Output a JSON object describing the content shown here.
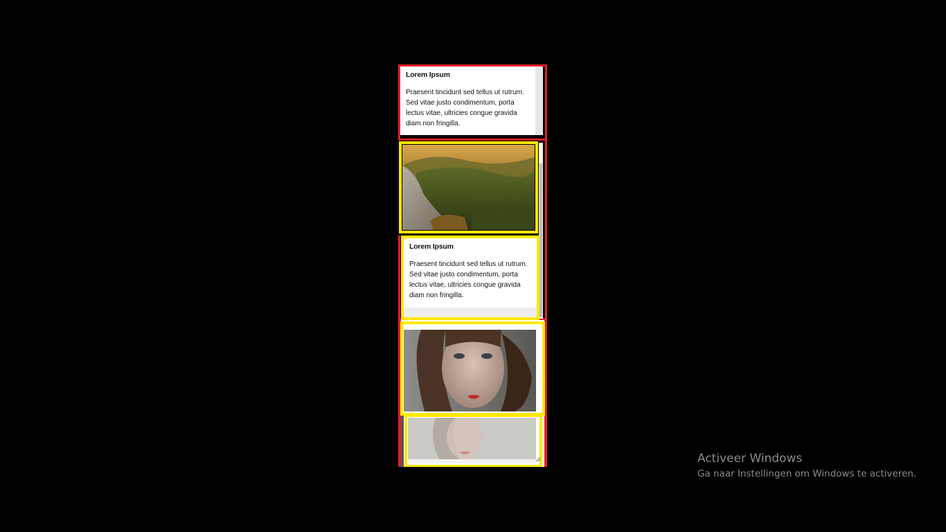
{
  "cards": [
    {
      "title": "Lorem Ipsum",
      "body": "Praesent tincidunt sed tellus ut rutrum. Sed vitae justo condimentum, porta lectus vitae, ultricies congue gravida diam non fringilla."
    },
    {
      "title": "Lorem Ipsum",
      "body": "Praesent tincidunt sed tellus ut rutrum. Sed vitae justo condimentum, porta lectus vitae, ultricies congue gravida diam non fringilla."
    }
  ],
  "images": [
    {
      "name": "mountain-landscape-image",
      "alt": "Mountain landscape"
    },
    {
      "name": "woman-portrait-image",
      "alt": "Woman portrait"
    },
    {
      "name": "woman-portrait-faded-image",
      "alt": "Woman portrait faded"
    }
  ],
  "watermark": {
    "title": "Activeer Windows",
    "subtitle": "Ga naar Instellingen om Windows te activeren."
  },
  "colors": {
    "outline_red": "#e0202a",
    "outline_yellow": "#ffe800",
    "background": "#000000",
    "card_bg": "#ffffff"
  }
}
